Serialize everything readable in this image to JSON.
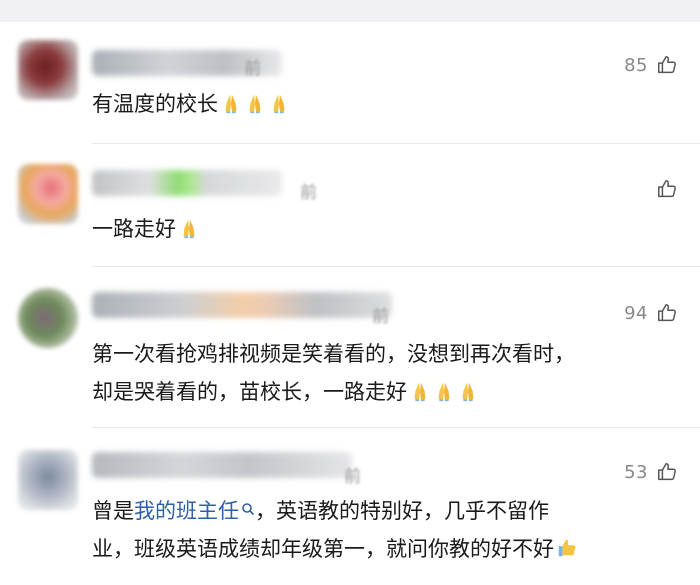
{
  "comments": [
    {
      "time": "前",
      "likes": "85",
      "text": "有温度的校长",
      "emoji_count": 3
    },
    {
      "time": "前",
      "likes": "",
      "text": "一路走好",
      "emoji_count": 1
    },
    {
      "time": "前",
      "likes": "94",
      "line1": "第一次看抢鸡排视频是笑着看的，没想到再次看时，",
      "line2": "却是哭着看的，苗校长，一路走好",
      "emoji_count": 3
    },
    {
      "time": "前",
      "likes": "53",
      "prefix": "曾是",
      "link": "我的班主任",
      "line1_rest": "，英语教的特别好，几乎不留作",
      "line2": "业，班级英语成绩却年级第一，就问你教的好不好"
    }
  ],
  "icons": {
    "like": "thumbs-up-icon",
    "pray": "folded-hands-emoji",
    "search": "search-icon",
    "thumbs_up_emoji": "thumbs-up-emoji"
  },
  "colors": {
    "link": "#2f5fa7",
    "meta_gray": "#888888",
    "divider": "#e8e8e8"
  }
}
